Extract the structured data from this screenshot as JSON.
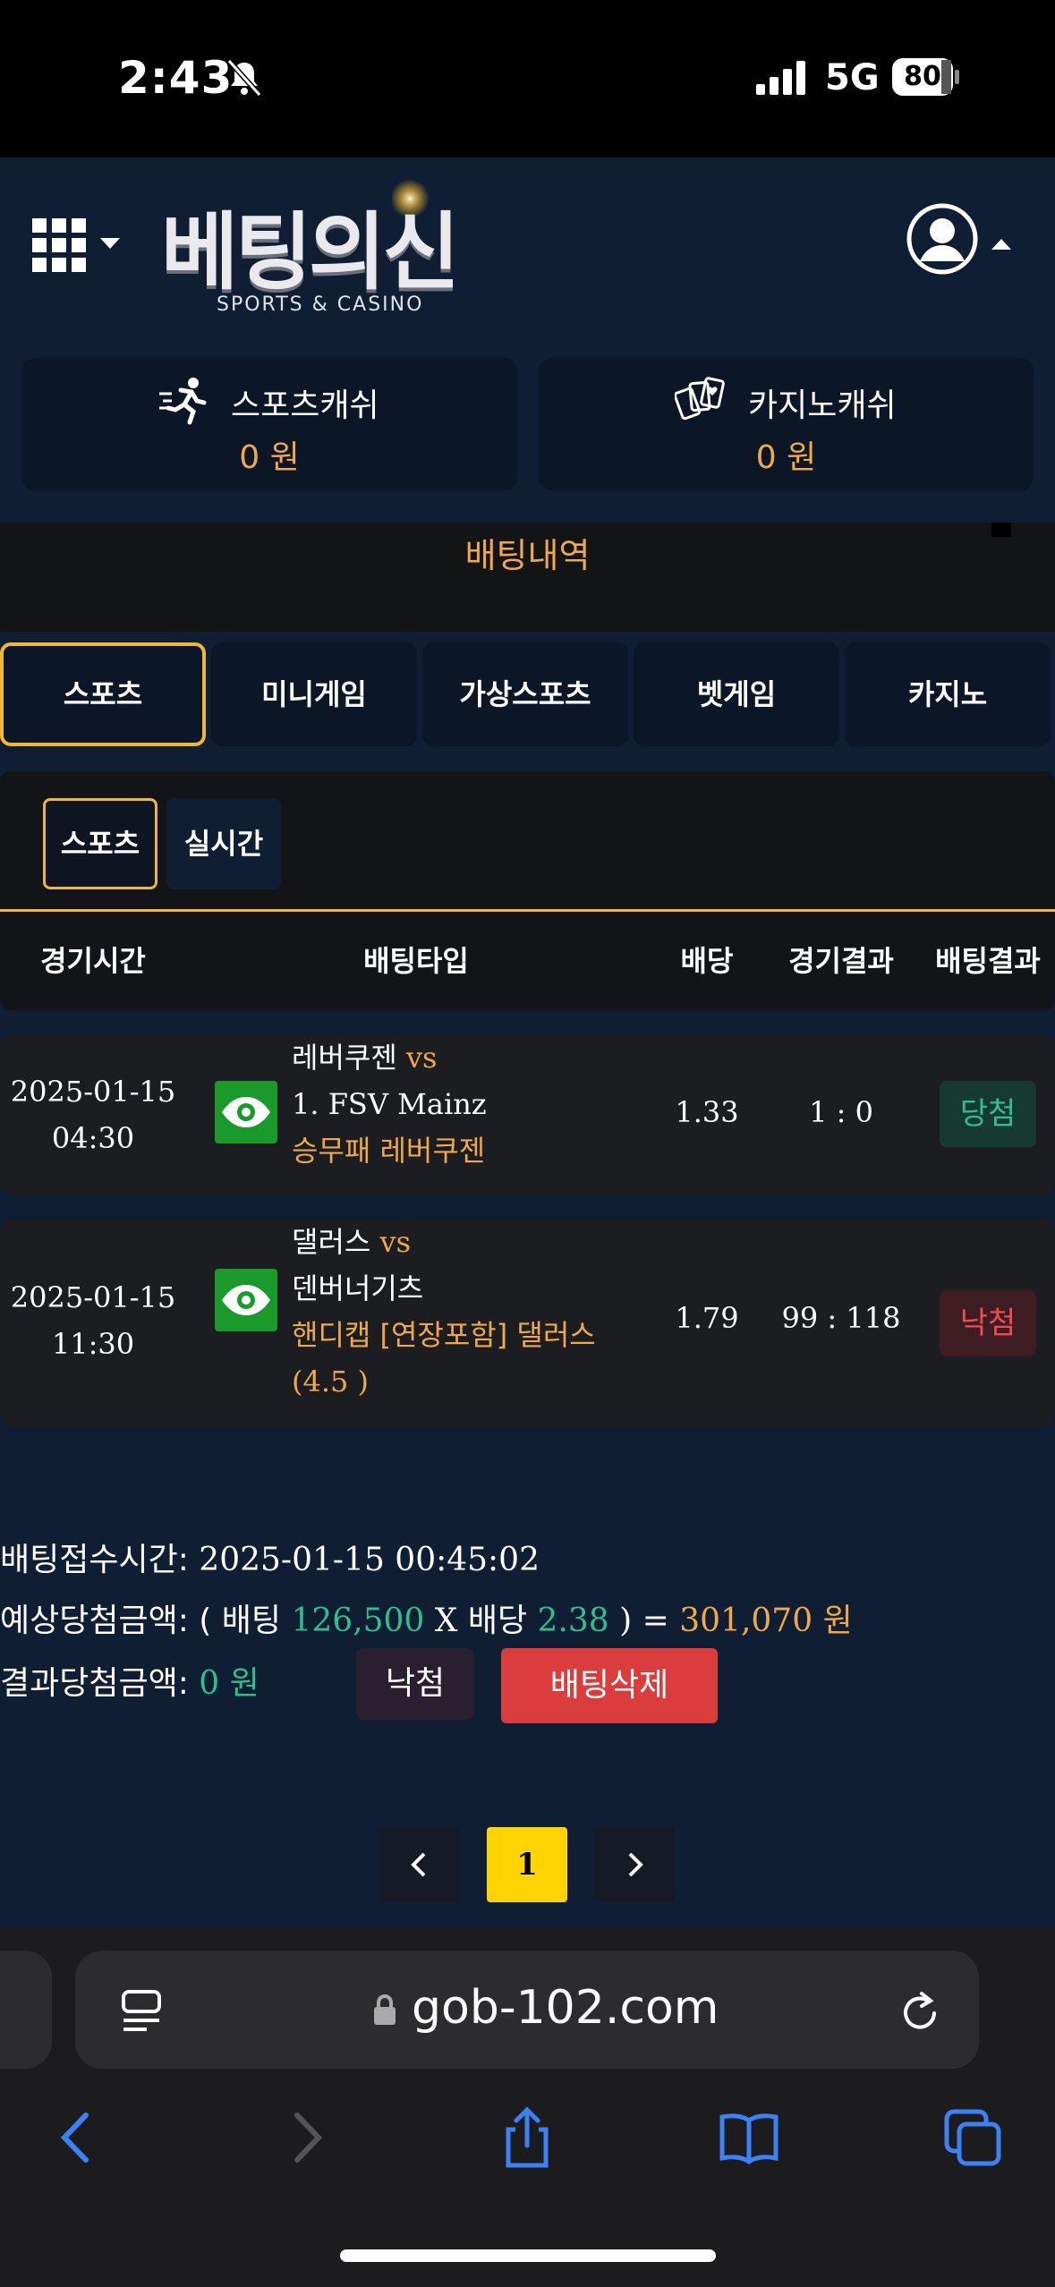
{
  "status": {
    "time": "2:43",
    "network": "5G",
    "battery": "80"
  },
  "header": {
    "logo_text": "베팅의신",
    "logo_sub": "SPORTS & CASINO",
    "sports_cash_label": "스포츠캐쉬",
    "sports_cash_value": "0 원",
    "casino_cash_label": "카지노캐쉬",
    "casino_cash_value": "0 원"
  },
  "page_title": "배팅내역",
  "main_tabs": [
    {
      "label": "스포츠",
      "active": true
    },
    {
      "label": "미니게임",
      "active": false
    },
    {
      "label": "가상스포츠",
      "active": false
    },
    {
      "label": "벳게임",
      "active": false
    },
    {
      "label": "카지노",
      "active": false
    }
  ],
  "sub_tabs": [
    {
      "label": "스포츠",
      "active": true
    },
    {
      "label": "실시간",
      "active": false
    }
  ],
  "table": {
    "headers": [
      "경기시간",
      "배팅타입",
      "배당",
      "경기결과",
      "배팅결과"
    ],
    "rows": [
      {
        "date": "2025-01-15",
        "time": "04:30",
        "home": "레버쿠젠",
        "vs": "vs",
        "away": "1. FSV Mainz",
        "pick_line1": "승무패 레버쿠젠",
        "pick_line2": "",
        "odds": "1.33",
        "score": "1 : 0",
        "result": "당첨"
      },
      {
        "date": "2025-01-15",
        "time": "11:30",
        "home": "댈러스",
        "vs": "vs",
        "away": "덴버너기츠",
        "pick_line1": "핸디캡 [연장포함] 댈러스",
        "pick_line2": "(4.5 )",
        "odds": "1.79",
        "score": "99 : 118",
        "result": "낙첨"
      }
    ]
  },
  "summary": {
    "accept_label": "배팅접수시간: ",
    "accept_time": "2025-01-15 00:45:02",
    "expected_label": "예상당첨금액: ( 배팅 ",
    "stake": "126,500",
    "x_odds": " X 배당 ",
    "total_odds": "2.38",
    "close_eq": " ) = ",
    "expected_payout": "301,070 원",
    "result_label": "결과당첨금액: ",
    "result_amount": "0 원",
    "status_button": "낙첨",
    "delete_button": "배팅삭제"
  },
  "pagination": {
    "current": "1"
  },
  "browser": {
    "url": "gob-102.com"
  },
  "colors": {
    "accent": "#f1b730",
    "orange": "#f0a94a",
    "green": "#2dbf8c",
    "red": "#db3c3c",
    "navy": "#0f1e33"
  },
  "icons": [
    "silent-icon",
    "signal-icon",
    "battery-icon",
    "grid-menu-icon",
    "avatar-icon",
    "sports-runner-icon",
    "casino-cards-icon",
    "eye-icon",
    "chevron-left-icon",
    "chevron-right-icon",
    "reader-icon",
    "lock-icon",
    "reload-icon",
    "back-icon",
    "forward-icon",
    "share-icon",
    "bookmarks-icon",
    "tabs-icon"
  ]
}
